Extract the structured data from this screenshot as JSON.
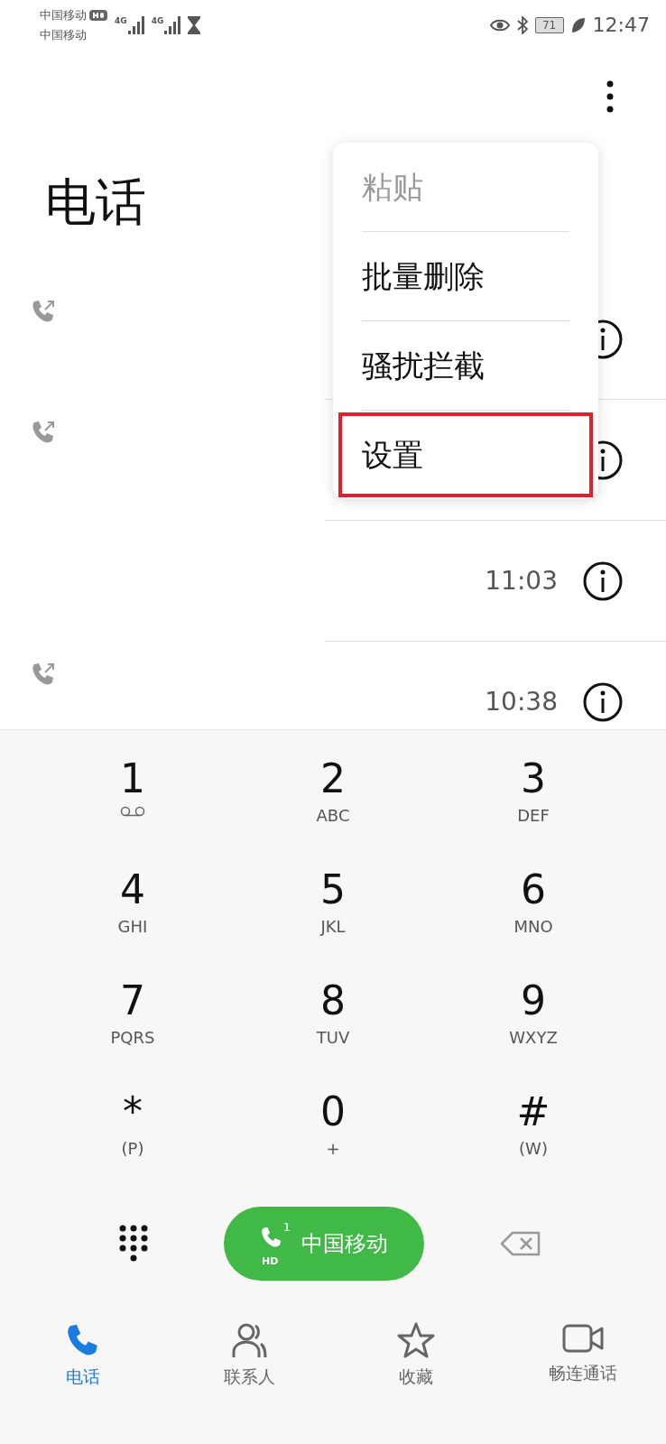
{
  "status_bar": {
    "carriers": [
      {
        "name": "中国移动",
        "hd": true
      },
      {
        "name": "中国移动",
        "hd": false
      }
    ],
    "signals": [
      {
        "network": "4G"
      },
      {
        "network": "4G"
      }
    ],
    "battery": "71",
    "time": "12:47"
  },
  "title": "电话",
  "calls": [
    {
      "outgoing": true
    },
    {
      "outgoing": true
    },
    {
      "outgoing": false,
      "time": "11:03"
    },
    {
      "outgoing": true,
      "time": "10:38"
    }
  ],
  "menu": [
    {
      "label": "粘贴",
      "disabled": true,
      "highlighted": false
    },
    {
      "label": "批量删除",
      "disabled": false,
      "highlighted": false
    },
    {
      "label": "骚扰拦截",
      "disabled": false,
      "highlighted": false
    },
    {
      "label": "设置",
      "disabled": false,
      "highlighted": true
    }
  ],
  "keys": [
    {
      "kind": "voicemail",
      "digit": "1"
    },
    {
      "kind": "letters",
      "digit": "2",
      "letters": "ABC"
    },
    {
      "kind": "letters",
      "digit": "3",
      "letters": "DEF"
    },
    {
      "kind": "letters",
      "digit": "4",
      "letters": "GHI"
    },
    {
      "kind": "letters",
      "digit": "5",
      "letters": "JKL"
    },
    {
      "kind": "letters",
      "digit": "6",
      "letters": "MNO"
    },
    {
      "kind": "letters",
      "digit": "7",
      "letters": "PQRS"
    },
    {
      "kind": "letters",
      "digit": "8",
      "letters": "TUV"
    },
    {
      "kind": "letters",
      "digit": "9",
      "letters": "WXYZ"
    },
    {
      "kind": "letters",
      "digit": "*",
      "letters": "(P)"
    },
    {
      "kind": "letters",
      "digit": "0",
      "letters": "+"
    },
    {
      "kind": "letters",
      "digit": "#",
      "letters": "(W)"
    }
  ],
  "call_button": {
    "sim": "1",
    "hd": "HD",
    "label": "中国移动"
  },
  "tabs": [
    {
      "kind": "phone",
      "label": "电话",
      "selected": true
    },
    {
      "kind": "contacts",
      "label": "联系人",
      "selected": false
    },
    {
      "kind": "favorites",
      "label": "收藏",
      "selected": false
    },
    {
      "kind": "video",
      "label": "畅连通话",
      "selected": false
    }
  ]
}
